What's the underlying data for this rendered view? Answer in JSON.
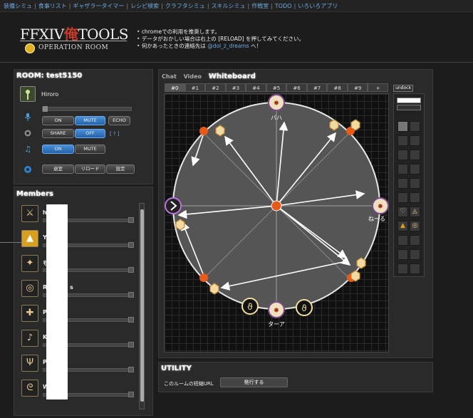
{
  "nav": [
    "装備シミュ",
    "食事リスト",
    "ギャザラータイマー",
    "レシピ検索",
    "クラフタシミュ",
    "スキルシミュ",
    "作戦室",
    "TODO",
    "いろいろアプリ"
  ],
  "logo": {
    "left": "FFXIV",
    "mid": "俺",
    "right": "TOOLS",
    "sub": "OPERATION ROOM"
  },
  "notes": {
    "line1": "chromeでの利用を推奨します。",
    "line2": "データがおかしい場合は右上の [RELOAD] を押してみてください。",
    "line3_pre": "何かあったときの連絡先は ",
    "line3_handle": "@dol_z_dreams",
    "line3_post": " へ！"
  },
  "room": {
    "title": "ROOM: test5150",
    "user": "Hiroro",
    "mic": {
      "on": "ON",
      "mute": "MUTE",
      "echo": "ECHO"
    },
    "screen": {
      "share": "SHARE",
      "off": "OFF",
      "help": "[ ? ]"
    },
    "music": {
      "on": "ON",
      "mute": "MUTE"
    },
    "settings": {
      "b1": "退室",
      "b2": "リロード",
      "b3": "設定"
    }
  },
  "members": {
    "title": "Members",
    "list": [
      {
        "initial": "h",
        "icon": "⚔"
      },
      {
        "initial": "Y",
        "icon": "▲"
      },
      {
        "initial": "も",
        "icon": "✦"
      },
      {
        "initial": "R",
        "icon": "◎",
        "suffix": "s"
      },
      {
        "initial": "P",
        "icon": "✚"
      },
      {
        "initial": "K",
        "icon": "♪"
      },
      {
        "initial": "P",
        "icon": "Ψ"
      },
      {
        "initial": "W",
        "icon": "ᘓ"
      }
    ]
  },
  "board": {
    "tabs": [
      "Chat",
      "Video",
      "Whiteboard"
    ],
    "pages": [
      "#0",
      "#1",
      "#2",
      "#3",
      "#4",
      "#5",
      "#6",
      "#7",
      "#8",
      "#9",
      "+"
    ],
    "undock": "undock",
    "labels": {
      "top": "バハ",
      "right": "ねーる",
      "bottom": "ターア"
    }
  },
  "utility": {
    "title": "UTILITY",
    "label": "このルームの短縮URL",
    "button": "発行する"
  }
}
